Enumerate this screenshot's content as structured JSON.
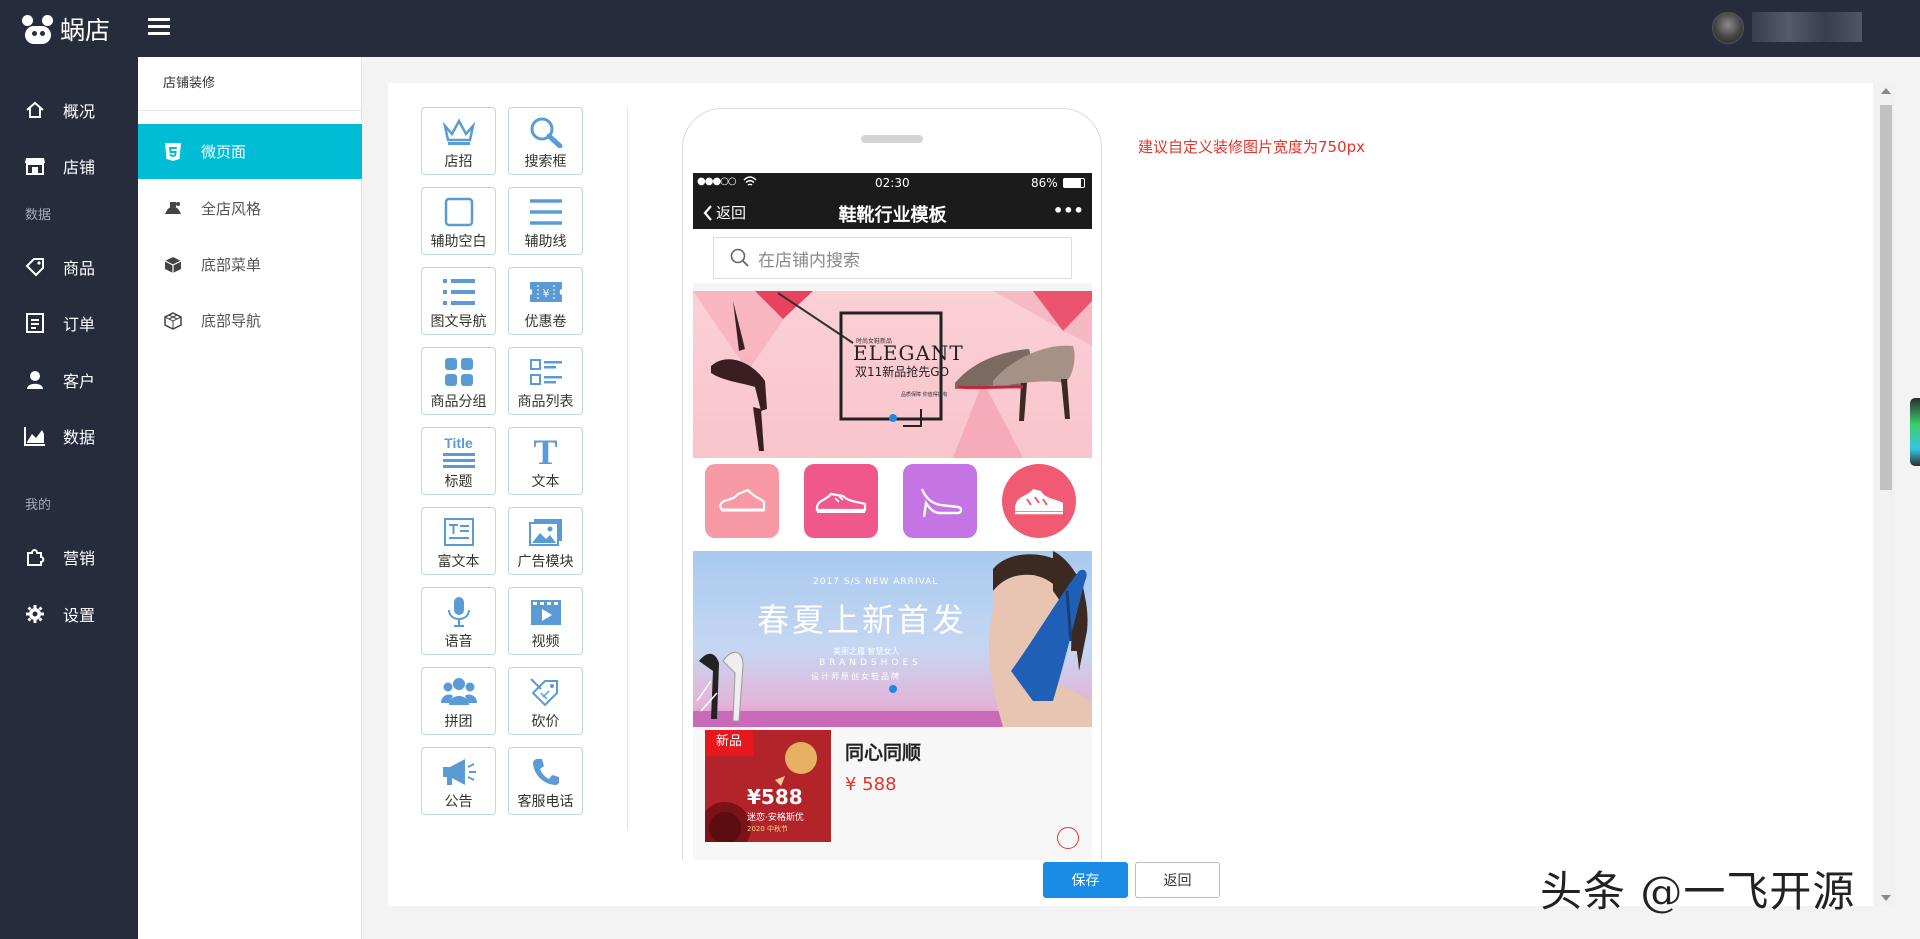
{
  "app": {
    "name": "蜗店",
    "user_name": ""
  },
  "sidebar": {
    "items": [
      {
        "label": "概况",
        "icon": "home-icon"
      },
      {
        "label": "店铺",
        "icon": "store-icon"
      },
      {
        "label": "商品",
        "icon": "tag-icon"
      },
      {
        "label": "订单",
        "icon": "order-list-icon"
      },
      {
        "label": "客户",
        "icon": "user-icon"
      },
      {
        "label": "数据",
        "icon": "chart-icon"
      },
      {
        "label": "营销",
        "icon": "puzzle-icon"
      },
      {
        "label": "设置",
        "icon": "gear-icon"
      }
    ],
    "sections": [
      "数据",
      "我的"
    ]
  },
  "submenu": {
    "title": "店铺装修",
    "items": [
      {
        "label": "微页面",
        "icon": "html5-icon",
        "active": true
      },
      {
        "label": "全店风格",
        "icon": "palette-icon",
        "active": false
      },
      {
        "label": "底部菜单",
        "icon": "cube-icon",
        "active": false
      },
      {
        "label": "底部导航",
        "icon": "cubes-icon",
        "active": false
      }
    ]
  },
  "widgets": [
    {
      "label": "店招",
      "icon": "crown-icon"
    },
    {
      "label": "搜索框",
      "icon": "search-icon"
    },
    {
      "label": "辅助空白",
      "icon": "blank-square-icon"
    },
    {
      "label": "辅助线",
      "icon": "lines-icon"
    },
    {
      "label": "图文导航",
      "icon": "list-icon"
    },
    {
      "label": "优惠卷",
      "icon": "coupon-icon"
    },
    {
      "label": "商品分组",
      "icon": "grid-icon"
    },
    {
      "label": "商品列表",
      "icon": "product-list-icon"
    },
    {
      "label": "标题",
      "icon": "title-icon",
      "icon_text": "Title"
    },
    {
      "label": "文本",
      "icon": "text-icon",
      "icon_text": "T"
    },
    {
      "label": "富文本",
      "icon": "rich-text-icon"
    },
    {
      "label": "广告模块",
      "icon": "image-icon"
    },
    {
      "label": "语音",
      "icon": "microphone-icon"
    },
    {
      "label": "视频",
      "icon": "video-icon"
    },
    {
      "label": "拼团",
      "icon": "group-icon"
    },
    {
      "label": "砍价",
      "icon": "price-tag-icon"
    },
    {
      "label": "公告",
      "icon": "megaphone-icon"
    },
    {
      "label": "客服电话",
      "icon": "phone-icon"
    }
  ],
  "phone": {
    "status": {
      "signal": "●●●○○",
      "time": "02:30",
      "battery": "86%"
    },
    "back_label": "返回",
    "title": "鞋靴行业模板",
    "more": "•••",
    "search_placeholder": "在店铺内搜索",
    "banner1": {
      "tag_small": "时尚女鞋新品",
      "headline": "ELEGANT",
      "subline": "双11新品抢先GO",
      "caption": "品质保障 你值得拥有"
    },
    "banner2": {
      "top_text": "2017 S/S NEW ARRIVAL",
      "headline": "春夏上新首发",
      "line1": "美丽之履  智慧女人",
      "line2": "BRANDSHOES",
      "line3": "设计师原创女鞋品牌"
    },
    "product": {
      "badge": "新品",
      "name": "同心同顺",
      "price": "¥ 588",
      "thumb_price": "¥588",
      "thumb_text": "迷恋·安格斯优",
      "thumb_year": "2020 中秋节"
    }
  },
  "tip": "建议自定义装修图片宽度为750px",
  "buttons": {
    "save": "保存",
    "back": "返回"
  },
  "watermark": "头条 @一飞开源",
  "colors": {
    "sidebar_bg": "#272c3d",
    "active": "#00bcd4",
    "primary": "#1a8ce6",
    "tip": "#e0352b",
    "icon_blue": "#5b9bd5"
  }
}
